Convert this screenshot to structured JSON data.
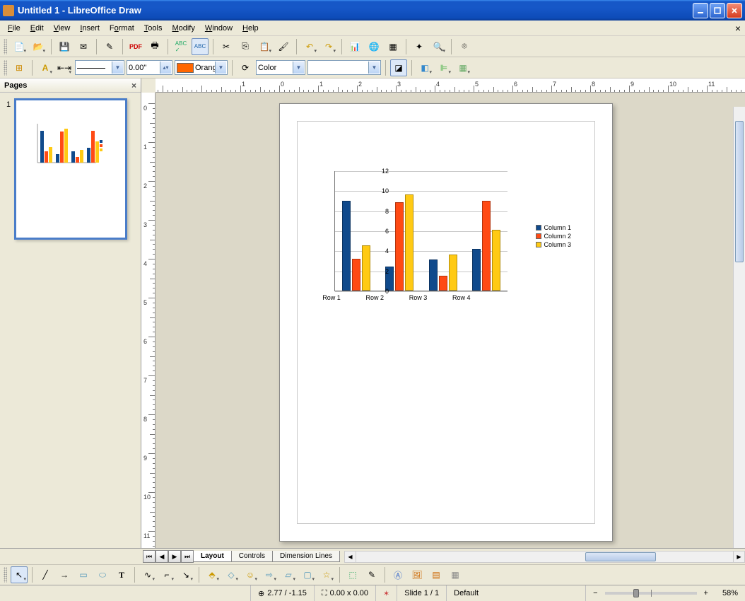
{
  "window": {
    "title": "Untitled 1 - LibreOffice Draw"
  },
  "menu": {
    "items": [
      "File",
      "Edit",
      "View",
      "Insert",
      "Format",
      "Tools",
      "Modify",
      "Window",
      "Help"
    ]
  },
  "toolbar2": {
    "line_width": "0.00\"",
    "fill_color_name": "Orange",
    "fill_swatch": "#ff6600",
    "color_scheme_label": "Color"
  },
  "pages_panel": {
    "title": "Pages",
    "page_number": "1"
  },
  "ruler": {
    "marks": [
      -1,
      0,
      1,
      2,
      3,
      4,
      5,
      6,
      7,
      8,
      9,
      10,
      11
    ],
    "vmarks": [
      0,
      1,
      2,
      3,
      4,
      5,
      6,
      7,
      8,
      9,
      10
    ]
  },
  "tabs": {
    "layout": "Layout",
    "controls": "Controls",
    "dimension": "Dimension Lines"
  },
  "status": {
    "pos": "2.77 / -1.15",
    "size": "0.00 x 0.00",
    "slide": "Slide 1 / 1",
    "style": "Default",
    "zoom": "58%"
  },
  "chart_data": {
    "type": "bar",
    "categories": [
      "Row 1",
      "Row 2",
      "Row 3",
      "Row 4"
    ],
    "series": [
      {
        "name": "Column 1",
        "color": "#104a8c",
        "values": [
          9.0,
          2.4,
          3.1,
          4.2
        ]
      },
      {
        "name": "Column 2",
        "color": "#ff4a14",
        "values": [
          3.2,
          8.8,
          1.5,
          9.0
        ]
      },
      {
        "name": "Column 3",
        "color": "#ffca14",
        "values": [
          4.5,
          9.6,
          3.6,
          6.1
        ]
      }
    ],
    "ylim": [
      0,
      12
    ],
    "yticks": [
      0,
      2,
      4,
      6,
      8,
      10,
      12
    ]
  }
}
